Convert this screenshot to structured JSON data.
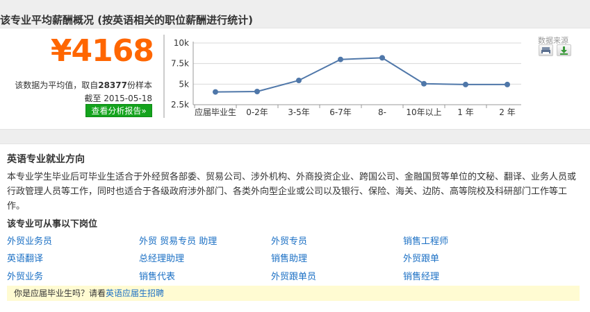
{
  "salary_section": {
    "title": "该专业平均薪酬概况 (按英语相关的职位薪酬进行统计)",
    "amount": "¥4168",
    "note_prefix": "该数据为平均值，取自",
    "sample_count": "28377",
    "note_suffix": "份样本",
    "date_label": "截至 2015-05-18",
    "report_button": "查看分析报告»",
    "source_label": "数据来源"
  },
  "chart_data": {
    "type": "line",
    "categories": [
      "应届毕业生",
      "0-2年",
      "3-5年",
      "6-7年",
      "8-",
      "10年以上",
      "1 年",
      "2 年"
    ],
    "values": [
      4050,
      4100,
      5450,
      8000,
      8200,
      5050,
      4950,
      4950
    ],
    "yticks": [
      "2.5k",
      "5k",
      "7.5k",
      "10k"
    ],
    "ylim": [
      2500,
      10000
    ],
    "grid": true,
    "line_color": "#4f77a9"
  },
  "employment_section": {
    "title": "英语专业就业方向",
    "description": "本专业学生毕业后可毕业生适合于外经贸各部委、贸易公司、涉外机构、外商投资企业、跨国公司、金融国贸等单位的文秘、翻译、业务人员或行政管理人员等工作，同时也适合于各级政府涉外部门、各类外向型企业或公司以及银行、保险、海关、边防、高等院校及科研部门工作等工作。",
    "jobs_title": "该专业可从事以下岗位",
    "jobs": [
      [
        "外贸业务员",
        "外贸 贸易专员 助理",
        "外贸专员",
        "销售工程师"
      ],
      [
        "英语翻译",
        "总经理助理",
        "销售助理",
        "外贸跟单"
      ],
      [
        "外贸业务",
        "销售代表",
        "外贸跟单员",
        "销售经理"
      ]
    ],
    "notice_prefix": "你是应届毕业生吗？请看",
    "notice_link": "英语应届生招聘"
  }
}
